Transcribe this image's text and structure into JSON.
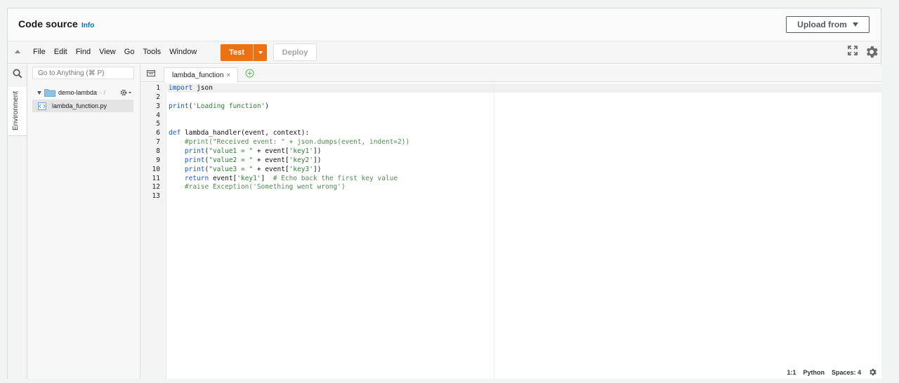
{
  "header": {
    "title": "Code source",
    "info_label": "Info",
    "upload_label": "Upload from"
  },
  "menu": [
    "File",
    "Edit",
    "Find",
    "View",
    "Go",
    "Tools",
    "Window"
  ],
  "toolbar": {
    "test_label": "Test",
    "deploy_label": "Deploy"
  },
  "sidebar": {
    "environment_label": "Environment"
  },
  "tree": {
    "search_placeholder": "Go to Anything (⌘ P)",
    "folder_name": "demo-lambda",
    "folder_path": "- /",
    "file_name": "lambda_function.py"
  },
  "editor": {
    "tab_label": "lambda_function",
    "lines": [
      [
        {
          "t": "import",
          "c": "kw"
        },
        {
          "t": " json",
          "c": "plain"
        }
      ],
      [],
      [
        {
          "t": "print",
          "c": "kw"
        },
        {
          "t": "(",
          "c": "plain"
        },
        {
          "t": "'Loading function'",
          "c": "str"
        },
        {
          "t": ")",
          "c": "plain"
        }
      ],
      [],
      [],
      [
        {
          "t": "def",
          "c": "kw"
        },
        {
          "t": " lambda_handler(event, context):",
          "c": "plain"
        }
      ],
      [
        {
          "t": "    #print(\"Received event: \" + json.dumps(event, indent=2))",
          "c": "cm"
        }
      ],
      [
        {
          "t": "    ",
          "c": "plain"
        },
        {
          "t": "print",
          "c": "kw"
        },
        {
          "t": "(",
          "c": "plain"
        },
        {
          "t": "\"value1 = \"",
          "c": "str"
        },
        {
          "t": " + event[",
          "c": "plain"
        },
        {
          "t": "'key1'",
          "c": "str"
        },
        {
          "t": "])",
          "c": "plain"
        }
      ],
      [
        {
          "t": "    ",
          "c": "plain"
        },
        {
          "t": "print",
          "c": "kw"
        },
        {
          "t": "(",
          "c": "plain"
        },
        {
          "t": "\"value2 = \"",
          "c": "str"
        },
        {
          "t": " + event[",
          "c": "plain"
        },
        {
          "t": "'key2'",
          "c": "str"
        },
        {
          "t": "])",
          "c": "plain"
        }
      ],
      [
        {
          "t": "    ",
          "c": "plain"
        },
        {
          "t": "print",
          "c": "kw"
        },
        {
          "t": "(",
          "c": "plain"
        },
        {
          "t": "\"value3 = \"",
          "c": "str"
        },
        {
          "t": " + event[",
          "c": "plain"
        },
        {
          "t": "'key3'",
          "c": "str"
        },
        {
          "t": "])",
          "c": "plain"
        }
      ],
      [
        {
          "t": "    ",
          "c": "plain"
        },
        {
          "t": "return",
          "c": "kw"
        },
        {
          "t": " event[",
          "c": "plain"
        },
        {
          "t": "'key1'",
          "c": "str"
        },
        {
          "t": "]  ",
          "c": "plain"
        },
        {
          "t": "# Echo back the first key value",
          "c": "cm"
        }
      ],
      [
        {
          "t": "    #raise Exception('Something went wrong')",
          "c": "cm"
        }
      ],
      []
    ],
    "line_numbers": [
      "1",
      "2",
      "3",
      "4",
      "5",
      "6",
      "7",
      "8",
      "9",
      "10",
      "11",
      "12",
      "13"
    ]
  },
  "status": {
    "position": "1:1",
    "language": "Python",
    "spaces": "Spaces: 4"
  },
  "colors": {
    "kw": "#1a55c4",
    "str": "#2e7d32",
    "cm": "#4f8a4f",
    "plain": "#111111",
    "accent": "#ec7211"
  }
}
